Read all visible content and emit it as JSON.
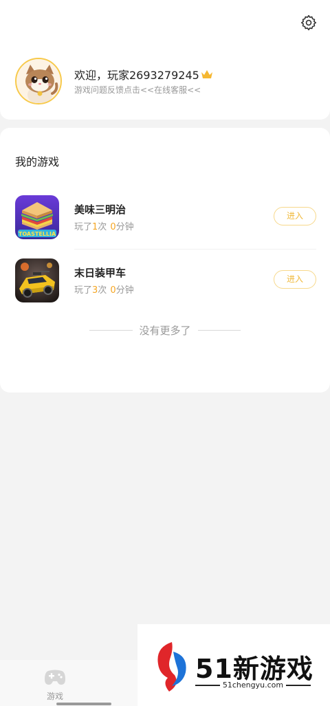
{
  "profile": {
    "welcome_text": "欢迎，玩家2693279245",
    "feedback_text": "游戏问题反馈点击<<在线客服<<"
  },
  "my_games": {
    "title": "我的游戏",
    "items": [
      {
        "name": "美味三明治",
        "stat_prefix": "玩了",
        "play_count": "1",
        "count_unit": "次",
        "minutes": "0",
        "minutes_unit": "分钟",
        "enter_label": "进入",
        "icon": "sandwich-game-icon"
      },
      {
        "name": "末日装甲车",
        "stat_prefix": "玩了",
        "play_count": "3",
        "count_unit": "次",
        "minutes": "0",
        "minutes_unit": "分钟",
        "enter_label": "进入",
        "icon": "armored-car-game-icon"
      }
    ],
    "end_text": "没有更多了"
  },
  "tabbar": {
    "tabs": [
      {
        "label": "游戏",
        "icon": "gamepad-icon"
      }
    ]
  },
  "watermark": {
    "brand": "51新游戏",
    "url": "51chengyu.com"
  },
  "colors": {
    "accent": "#f5a623",
    "button_border": "#f7d88a",
    "muted_text": "#999999"
  }
}
